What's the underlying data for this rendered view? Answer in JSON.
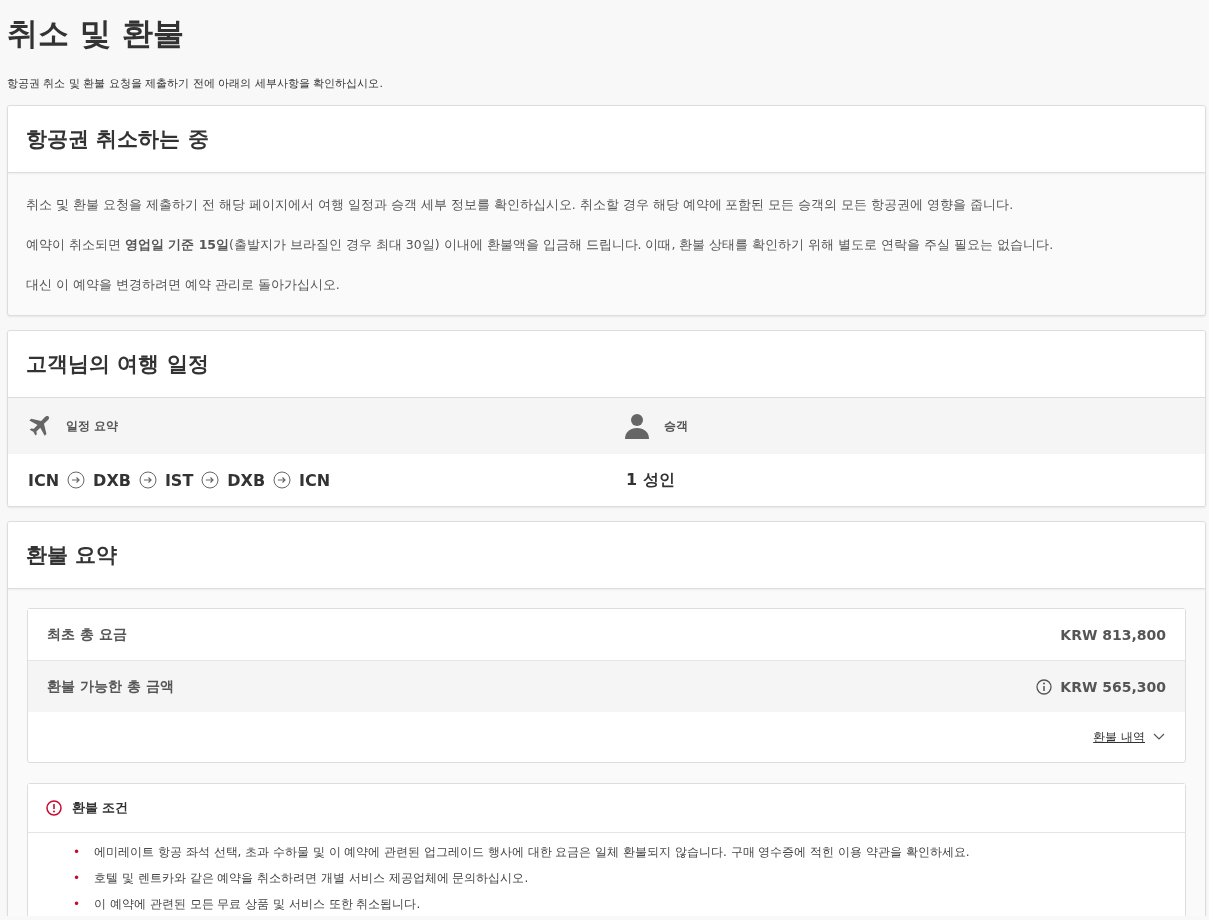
{
  "page": {
    "title": "취소 및 환불",
    "subtitle": "항공권 취소 및 환불 요청을 제출하기 전에 아래의 세부사항을 확인하십시오."
  },
  "cancel_card": {
    "title": "항공권 취소하는 중",
    "paragraphs": [
      "취소 및 환불 요청을 제출하기 전 해당 페이지에서 여행 일정과 승객 세부 정보를 확인하십시오. 취소할 경우 해당 예약에 포함된 모든 승객의 모든 항공권에 영향을 줍니다.",
      "예약이 취소되면 **영업일 기준 15일**(출발지가 브라질인 경우 최대 30일) 이내에 환불액을 입금해 드립니다. 이때, 환불 상태를 확인하기 위해 별도로 연락을 주실 필요는 없습니다.",
      "대신 이 예약을 변경하려면 예약 관리로 돌아가십시오."
    ]
  },
  "itinerary_card": {
    "title": "고객님의 여행 일정",
    "summary_label": "일정 요약",
    "passenger_label": "승객",
    "route": [
      "ICN",
      "DXB",
      "IST",
      "DXB",
      "ICN"
    ],
    "passengers": "1 성인"
  },
  "refund_card": {
    "title": "환불 요약",
    "rows": [
      {
        "label": "최초 총 요금",
        "amount": "KRW 813,800",
        "info": false
      },
      {
        "label": "환불 가능한 총 금액",
        "amount": "KRW 565,300",
        "info": true
      }
    ],
    "details_link": "환불 내역",
    "conditions": {
      "title": "환불 조건",
      "bullet": "•",
      "items": [
        "에미레이트 항공 좌석 선택, 초과 수하물 및 이 예약에 관련된 업그레이드 행사에 대한 요금은 일체 환불되지 않습니다. 구매 영수증에 적힌 이용 약관을 확인하세요.",
        "호텔 및 렌트카와 같은 예약을 취소하려면 개별 서비스 제공업체에 문의하십시오.",
        "이 예약에 관련된 모든 무료 상품 및 서비스 또한 취소됩니다."
      ]
    }
  }
}
